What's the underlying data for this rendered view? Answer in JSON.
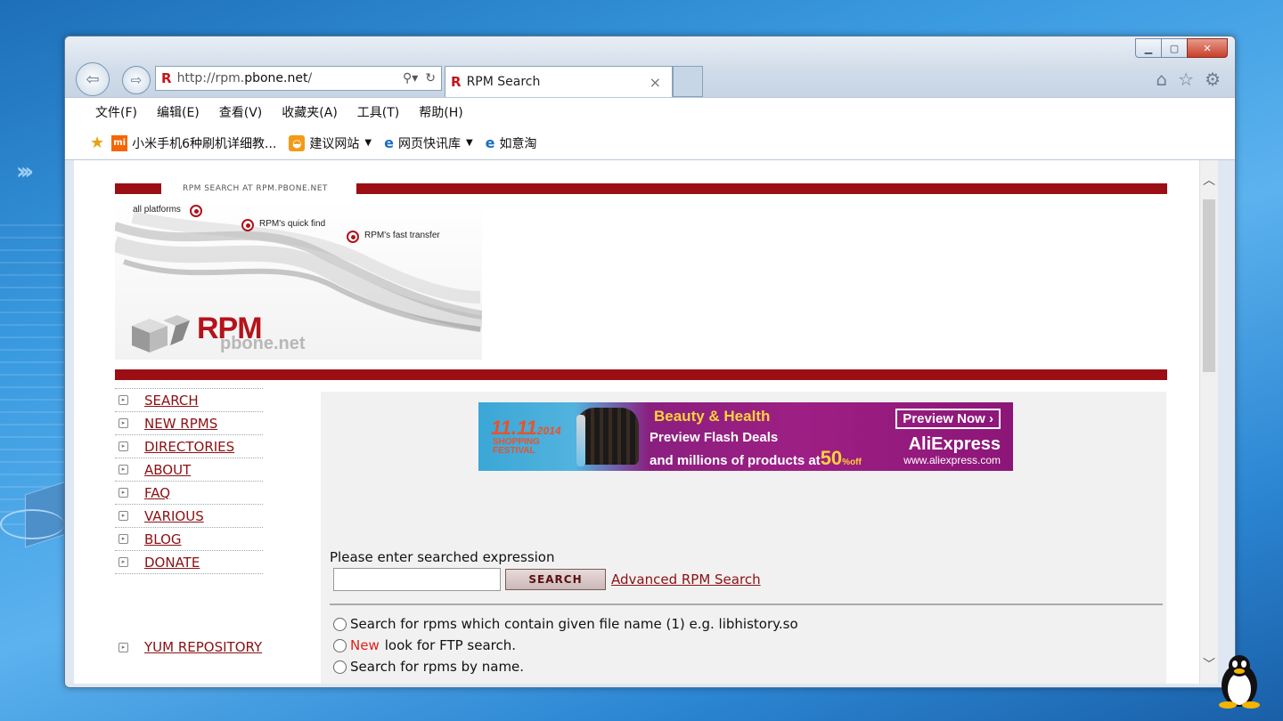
{
  "browser": {
    "address_url_prefix": "http://rpm.",
    "address_url_domain": "pbone.net",
    "address_url_suffix": "/",
    "tab_title": "RPM Search",
    "tab_close": "×",
    "menu": [
      "文件(F)",
      "编辑(E)",
      "查看(V)",
      "收藏夹(A)",
      "工具(T)",
      "帮助(H)"
    ],
    "favorites": [
      {
        "label": "小米手机6种刷机详细教...",
        "icon": "mi-icon",
        "dropdown": false
      },
      {
        "label": "建议网站",
        "icon": "suggested-sites-icon",
        "dropdown": true
      },
      {
        "label": "网页快讯库",
        "icon": "ie-icon",
        "dropdown": true
      },
      {
        "label": "如意淘",
        "icon": "ie-icon",
        "dropdown": false
      }
    ]
  },
  "site": {
    "header_text": "RPM SEARCH AT RPM.PBONE.NET",
    "banner_labels": [
      "all platforms",
      "RPM's quick find",
      "RPM's fast transfer"
    ],
    "logo_main": "RPM",
    "logo_sub": "pbone.net",
    "nav": [
      "SEARCH",
      "NEW RPMS",
      "DIRECTORIES",
      "ABOUT",
      "FAQ",
      "VARIOUS",
      "BLOG",
      "DONATE"
    ],
    "yum": "YUM REPOSITORY",
    "ad": {
      "date": "11.11",
      "year": "2014",
      "festival_line1": "SHOPPING",
      "festival_line2": "FESTIVAL",
      "headline": "Beauty & Health",
      "line1": "Preview Flash Deals",
      "line2_prefix": "and millions of products at",
      "percent": "50",
      "off": "%off",
      "cta": "Preview Now ›",
      "brand": "AliExpress",
      "url": "www.aliexpress.com"
    },
    "search": {
      "prompt": "Please enter searched expression",
      "button": "SEARCH",
      "advanced": "Advanced RPM Search",
      "input_value": ""
    },
    "options": [
      {
        "new": "",
        "text": "Search for rpms which contain given file name (1) e.g. libhistory.so"
      },
      {
        "new": "New",
        "text": "look for FTP search."
      },
      {
        "new": "",
        "text": "Search for rpms by name."
      }
    ]
  },
  "colors": {
    "accent": "#9b0f14",
    "link": "#8b1014",
    "new": "#e0211c"
  }
}
